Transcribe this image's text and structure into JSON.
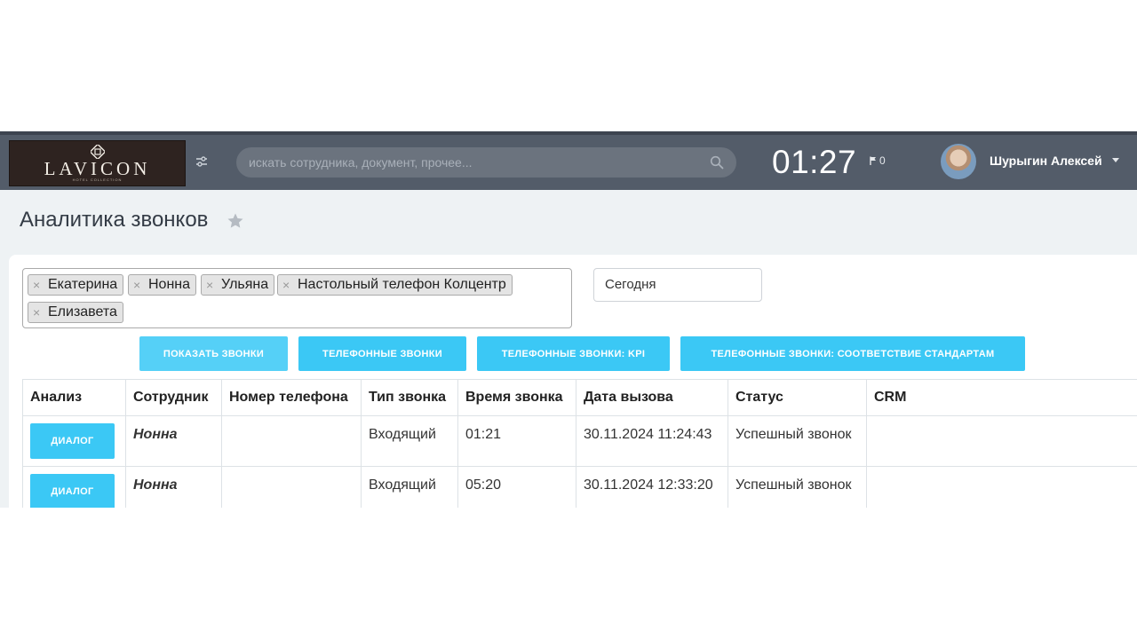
{
  "header": {
    "logo_text": "LAVICON",
    "logo_subtitle": "HOTEL COLLECTION",
    "search_placeholder": "искать сотрудника, документ, прочее...",
    "clock": "01:27",
    "flag_count": "0",
    "user_name": "Шурыгин Алексей",
    "icons": [
      "filter-sliders-icon",
      "search-icon",
      "flag-icon",
      "chevron-down-icon"
    ]
  },
  "page": {
    "title": "Аналитика звонков",
    "favorite_icon": "star-icon"
  },
  "filters": {
    "employees": [
      "Екатерина",
      "Нонна",
      "Ульяна",
      "Настольный телефон Колцентр",
      "Елизавета"
    ],
    "remove_glyph": "×",
    "period": "Сегодня"
  },
  "buttons": {
    "show_calls": "Показать звонки",
    "phone_calls": "Телефонные звонки",
    "phone_calls_kpi": "Телефонные звонки: KPI",
    "phone_calls_standards": "Телефонные звонки: соответствие стандартам"
  },
  "table": {
    "columns": [
      "Анализ",
      "Сотрудник",
      "Номер телефона",
      "Тип звонка",
      "Время звонка",
      "Дата вызова",
      "Статус",
      "CRM"
    ],
    "rows": [
      {
        "action": "ДИАЛОГ",
        "employee": "Нонна",
        "phone": "",
        "type": "Входящий",
        "duration": "01:21",
        "date": "30.11.2024 11:24:43",
        "status": "Успешный звонок",
        "crm": ""
      },
      {
        "action": "ДИАЛОГ",
        "employee": "Нонна",
        "phone": "",
        "type": "Входящий",
        "duration": "05:20",
        "date": "30.11.2024 12:33:20",
        "status": "Успешный звонок",
        "crm": ""
      }
    ]
  },
  "colors": {
    "topbar": "#535c69",
    "accent_button": "#3bc8f5",
    "page_background": "#eef2f4",
    "logo_background": "#2e2320"
  }
}
